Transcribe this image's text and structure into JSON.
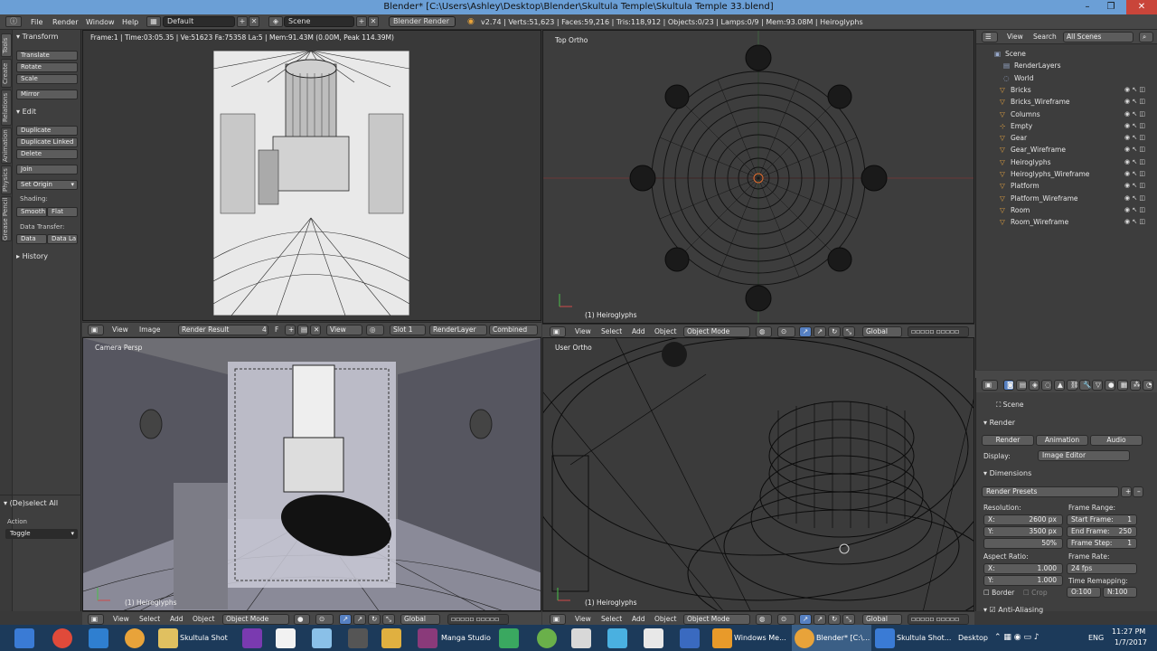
{
  "window": {
    "title": "Blender* [C:\\Users\\Ashley\\Desktop\\Blender\\Skultula Temple\\Skultula Temple 33.blend]"
  },
  "infobar": {
    "menus": [
      "File",
      "Render",
      "Window",
      "Help"
    ],
    "layout": "Default",
    "scene": "Scene",
    "engine": "Blender Render",
    "stats": "v2.74 | Verts:51,623 | Faces:59,216 | Tris:118,912 | Objects:0/23 | Lamps:0/9 | Mem:93.08M | Heiroglyphs"
  },
  "tabs": [
    "Tools",
    "Create",
    "Relations",
    "Animation",
    "Physics",
    "Grease Pencil"
  ],
  "toolshelf": {
    "transform_header": "Transform",
    "transform": [
      "Translate",
      "Rotate",
      "Scale"
    ],
    "mirror": "Mirror",
    "edit_header": "Edit",
    "edit": [
      "Duplicate",
      "Duplicate Linked",
      "Delete"
    ],
    "join": "Join",
    "set_origin": "Set Origin",
    "shading_label": "Shading:",
    "smooth": "Smooth",
    "flat": "Flat",
    "data_transfer_label": "Data Transfer:",
    "data": "Data",
    "data_la": "Data La",
    "history": "History",
    "op_header": "(De)select All",
    "action_label": "Action",
    "action_value": "Toggle"
  },
  "image_editor": {
    "frame_info": "Frame:1 | Time:03:05.35 | Ve:51623 Fa:75358 La:5 | Mem:91.43M (0.00M, Peak 114.39M)",
    "menus": [
      "View",
      "Image"
    ],
    "image_name": "Render Result",
    "users": "4",
    "fake": "F",
    "view_label": "View",
    "slot": "Slot 1",
    "layer": "RenderLayer",
    "pass": "Combined"
  },
  "top_view": {
    "label": "Top Ortho",
    "object": "(1) Heiroglyphs"
  },
  "cam_view": {
    "label": "Camera Persp",
    "object": "(1) Heiroglyphs"
  },
  "user_view": {
    "label": "User Ortho",
    "object": "(1) Heiroglyphs"
  },
  "view3d_header": {
    "menus": [
      "View",
      "Select",
      "Add",
      "Object"
    ],
    "mode": "Object Mode",
    "orientation": "Global"
  },
  "outliner": {
    "menus": [
      "View",
      "Search"
    ],
    "filter": "All Scenes",
    "items": [
      {
        "label": "Scene"
      },
      {
        "label": "RenderLayers"
      },
      {
        "label": "World"
      },
      {
        "label": "Bricks"
      },
      {
        "label": "Bricks_Wireframe"
      },
      {
        "label": "Columns"
      },
      {
        "label": "Empty"
      },
      {
        "label": "Gear"
      },
      {
        "label": "Gear_Wireframe"
      },
      {
        "label": "Heiroglyphs"
      },
      {
        "label": "Heiroglyphs_Wireframe"
      },
      {
        "label": "Platform"
      },
      {
        "label": "Platform_Wireframe"
      },
      {
        "label": "Room"
      },
      {
        "label": "Room_Wireframe"
      }
    ]
  },
  "properties": {
    "context": "Scene",
    "render_header": "Render",
    "render_btn": "Render",
    "animation_btn": "Animation",
    "audio_btn": "Audio",
    "display_label": "Display:",
    "display_value": "Image Editor",
    "dimensions_header": "Dimensions",
    "presets": "Render Presets",
    "resolution_label": "Resolution:",
    "res_x": "X:",
    "res_x_val": "2600 px",
    "res_y": "Y:",
    "res_y_val": "3500 px",
    "res_pct": "50%",
    "frame_range_label": "Frame Range:",
    "start_frame": "Start Frame:",
    "start_val": "1",
    "end_frame": "End Frame:",
    "end_val": "250",
    "frame_step": "Frame Step:",
    "step_val": "1",
    "aspect_label": "Aspect Ratio:",
    "asp_x_val": "1.000",
    "asp_y_val": "1.000",
    "frame_rate_label": "Frame Rate:",
    "fps": "24 fps",
    "remap_label": "Time Remapping:",
    "remap_old": "O:100",
    "remap_new": "N:100",
    "border": "Border",
    "crop": "Crop",
    "aa_header": "Anti-Aliasing"
  },
  "taskbar": {
    "apps": [
      "Skultula Shot",
      "Manga Studio",
      "Windows Me...",
      "Blender* [C:\\...",
      "Skultula Shot..."
    ],
    "desktop": "Desktop",
    "lang": "ENG",
    "time": "11:27 PM",
    "date": "1/7/2017"
  }
}
